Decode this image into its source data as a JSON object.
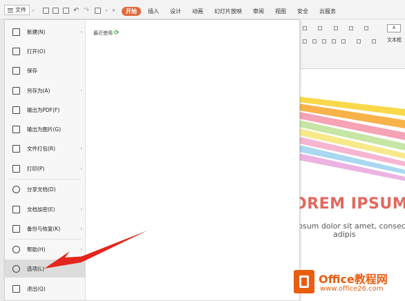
{
  "toolbar": {
    "file_label": "文件",
    "tabs": [
      "开始",
      "插入",
      "设计",
      "动画",
      "幻灯片放映",
      "审阅",
      "视图",
      "安全",
      "云服务"
    ],
    "active_tab": "开始"
  },
  "menu": {
    "items": [
      {
        "label": "新建(N)",
        "icon": "new-file-icon",
        "arrow": "›"
      },
      {
        "label": "打开(O)",
        "icon": "folder-open-icon",
        "arrow": ""
      },
      {
        "label": "保存",
        "icon": "save-icon",
        "arrow": ""
      },
      {
        "label": "另存为(A)",
        "icon": "save-as-icon",
        "arrow": "›"
      },
      {
        "label": "输出为PDF(F)",
        "icon": "pdf-icon",
        "arrow": ""
      },
      {
        "label": "输出为图片(G)",
        "icon": "image-export-icon",
        "arrow": ""
      },
      {
        "label": "文件打包(R)",
        "icon": "package-icon",
        "arrow": "›"
      },
      {
        "label": "打印(P)",
        "icon": "print-icon",
        "arrow": "›"
      },
      {
        "label": "分享文档(D)",
        "icon": "share-icon",
        "arrow": ""
      },
      {
        "label": "文档加密(E)",
        "icon": "encrypt-icon",
        "arrow": "›"
      },
      {
        "label": "备份与恢复(K)",
        "icon": "backup-icon",
        "arrow": "›"
      },
      {
        "label": "帮助(H)",
        "icon": "help-icon",
        "arrow": "›"
      },
      {
        "label": "选项(L)",
        "icon": "gear-icon",
        "arrow": ""
      },
      {
        "label": "退出(Q)",
        "icon": "exit-icon",
        "arrow": ""
      }
    ],
    "recent_label": "最近使用",
    "recent_icon": "refresh-icon"
  },
  "slide": {
    "title": "OREM IPSUM",
    "line1": "psum dolor sit amet, consec",
    "line2": "adipis"
  },
  "ribbon": {
    "text_box_label": "文本框"
  },
  "watermark": {
    "brand": "Office教程网",
    "url": "www.office26.com",
    "color": "#e95d0f"
  },
  "colors": {
    "accent_tab": "#e06a3a",
    "slide_title": "#e2685e",
    "arrow": "#e4261c"
  }
}
